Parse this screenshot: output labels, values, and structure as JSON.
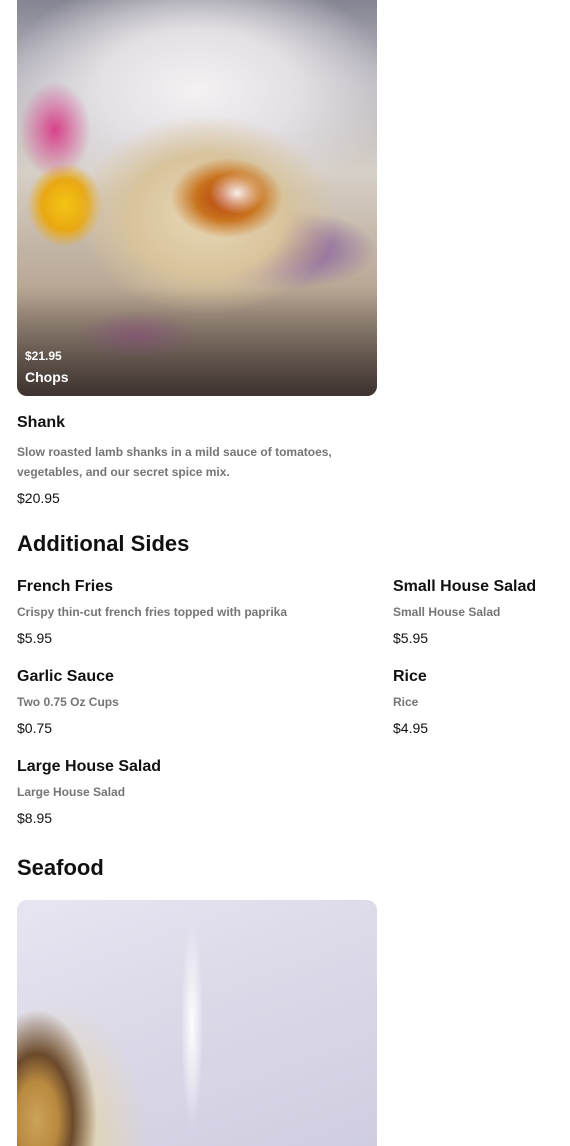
{
  "featured_top": {
    "price": "$21.95",
    "name": "Chops"
  },
  "shank": {
    "name": "Shank",
    "description": "Slow roasted lamb shanks in a mild sauce of tomatoes, vegetables, and our secret spice mix.",
    "price": "$20.95"
  },
  "additional_sides": {
    "title": "Additional Sides",
    "items": [
      {
        "name": "French Fries",
        "description": "Crispy thin-cut french fries topped with paprika",
        "price": "$5.95"
      },
      {
        "name": "Small House Salad",
        "description": "Small House Salad",
        "price": "$5.95"
      },
      {
        "name": "Garlic Sauce",
        "description": "Two 0.75 Oz Cups",
        "price": "$0.75"
      },
      {
        "name": "Rice",
        "description": "Rice",
        "price": "$4.95"
      },
      {
        "name": "Large House Salad",
        "description": "Large House Salad",
        "price": "$8.95"
      }
    ]
  },
  "seafood": {
    "title": "Seafood"
  }
}
